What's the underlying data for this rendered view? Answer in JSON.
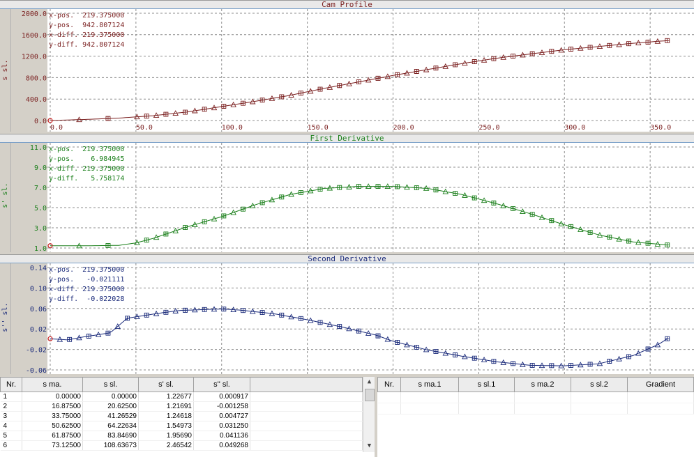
{
  "colors": {
    "p1": "#7a1f1f",
    "p2": "#1a7f1a",
    "p3": "#1a2a7a",
    "grid": "#8c8c8c",
    "marker_red": "#cc2222"
  },
  "panels": [
    {
      "title": "Cam Profile",
      "ylabel": "s sl.",
      "yticks": [
        "2000.0",
        "1600.0",
        "1200.0",
        "800.0",
        "400.0",
        "0.0"
      ],
      "readout": [
        "x-pos.  219.375000",
        "y-pos.  942.807124",
        "x-diff. 219.375000",
        "y-diff. 942.807124"
      ],
      "xticks": [
        "0.0",
        "50.0",
        "100.0",
        "150.0",
        "200.0",
        "250.0",
        "300.0",
        "350.0"
      ]
    },
    {
      "title": "First Derivative",
      "ylabel": "s' sl.",
      "yticks": [
        "11.0",
        "9.0",
        "7.0",
        "5.0",
        "3.0",
        "1.0"
      ],
      "readout": [
        "x-pos.  219.375000",
        "y-pos.    6.984945",
        "x-diff. 219.375000",
        "y-diff.   5.758174"
      ]
    },
    {
      "title": "Second Derivative",
      "ylabel": "s'' sl.",
      "yticks": [
        "0.14",
        "0.10",
        "0.06",
        "0.02",
        "-0.02",
        "-0.06"
      ],
      "readout": [
        "x-pos.  219.375000",
        "y-pos.   -0.021111",
        "x-diff. 219.375000",
        "y-diff.  -0.022028"
      ]
    }
  ],
  "chart_data": [
    {
      "type": "line",
      "title": "Cam Profile",
      "ylabel": "s sl.",
      "xlim": [
        0,
        365
      ],
      "ylim": [
        0,
        2000
      ],
      "x": [
        0,
        20,
        40,
        60,
        80,
        100,
        120,
        140,
        160,
        180,
        200,
        220,
        240,
        260,
        280,
        300,
        320,
        340,
        360
      ],
      "y": [
        0,
        20,
        45,
        90,
        160,
        260,
        360,
        470,
        600,
        720,
        840,
        950,
        1060,
        1160,
        1240,
        1320,
        1380,
        1440,
        1490
      ]
    },
    {
      "type": "line",
      "title": "First Derivative",
      "ylabel": "s' sl.",
      "xlim": [
        0,
        365
      ],
      "ylim": [
        1,
        11
      ],
      "x": [
        0,
        20,
        40,
        50,
        60,
        80,
        100,
        120,
        140,
        160,
        180,
        200,
        220,
        240,
        260,
        280,
        300,
        320,
        340,
        360
      ],
      "y": [
        1.23,
        1.22,
        1.26,
        1.5,
        1.95,
        3.1,
        4.1,
        5.3,
        6.3,
        6.9,
        7.1,
        7.1,
        6.9,
        6.3,
        5.4,
        4.4,
        3.3,
        2.3,
        1.6,
        1.3
      ]
    },
    {
      "type": "line",
      "title": "Second Derivative",
      "ylabel": "s'' sl.",
      "xlim": [
        0,
        365
      ],
      "ylim": [
        -0.06,
        0.14
      ],
      "x": [
        0,
        10,
        20,
        35,
        45,
        60,
        75,
        90,
        100,
        110,
        130,
        150,
        170,
        190,
        200,
        220,
        240,
        260,
        280,
        300,
        320,
        340,
        355,
        360
      ],
      "y": [
        0.0009,
        -0.0013,
        0.0047,
        0.0125,
        0.041,
        0.049,
        0.056,
        0.058,
        0.059,
        0.057,
        0.05,
        0.038,
        0.024,
        0.008,
        -0.004,
        -0.021,
        -0.033,
        -0.044,
        -0.051,
        -0.052,
        -0.048,
        -0.032,
        -0.01,
        0.001
      ]
    }
  ],
  "table1": {
    "headers": [
      "Nr.",
      "s ma.",
      "s sl.",
      "s' sl.",
      "s'' sl."
    ],
    "rows": [
      [
        "1",
        "0.00000",
        "0.00000",
        "1.22677",
        "0.000917"
      ],
      [
        "2",
        "16.87500",
        "20.62500",
        "1.21691",
        "-0.001258"
      ],
      [
        "3",
        "33.75000",
        "41.26529",
        "1.24618",
        "0.004727"
      ],
      [
        "4",
        "50.62500",
        "64.22634",
        "1.54973",
        "0.031250"
      ],
      [
        "5",
        "61.87500",
        "83.84690",
        "1.95690",
        "0.041136"
      ],
      [
        "6",
        "73.12500",
        "108.63673",
        "2.46542",
        "0.049268"
      ]
    ]
  },
  "table2": {
    "headers": [
      "Nr.",
      "s ma.1",
      "s sl.1",
      "s ma.2",
      "s sl.2",
      "Gradient"
    ]
  }
}
